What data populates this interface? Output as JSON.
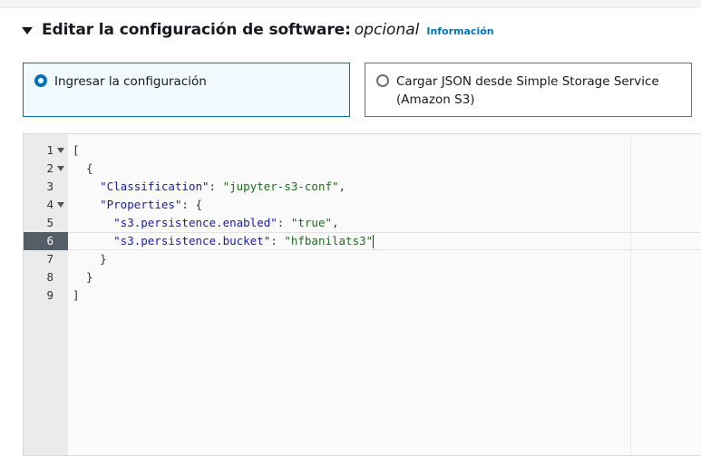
{
  "section": {
    "title": "Editar la configuración de software:",
    "title_suffix": "opcional",
    "info_link": "Información"
  },
  "options": [
    {
      "label": "Ingresar la configuración",
      "selected": true
    },
    {
      "label": "Cargar JSON desde Simple Storage Service (Amazon S3)",
      "selected": false
    }
  ],
  "editor": {
    "active_line": 6,
    "lines": [
      {
        "n": "1",
        "text": "["
      },
      {
        "n": "2",
        "text": "  {"
      },
      {
        "n": "3",
        "key": "\"Classification\"",
        "sep": ": ",
        "value": "\"jupyter-s3-conf\"",
        "tail": ",",
        "indent": "    "
      },
      {
        "n": "4",
        "key": "\"Properties\"",
        "sep": ": ",
        "tail": "{",
        "indent": "    "
      },
      {
        "n": "5",
        "key": "\"s3.persistence.enabled\"",
        "sep": ": ",
        "value": "\"true\"",
        "tail": ",",
        "indent": "      "
      },
      {
        "n": "6",
        "key": "\"s3.persistence.bucket\"",
        "sep": ": ",
        "value": "\"hfbanilats3\"",
        "tail": "",
        "indent": "      "
      },
      {
        "n": "7",
        "text": "    }"
      },
      {
        "n": "8",
        "text": "  }"
      },
      {
        "n": "9",
        "text": "]"
      }
    ]
  },
  "colors": {
    "accent": "#0073bb",
    "selected_tile_bg": "#f1faff",
    "gutter_active": "#555d66"
  }
}
